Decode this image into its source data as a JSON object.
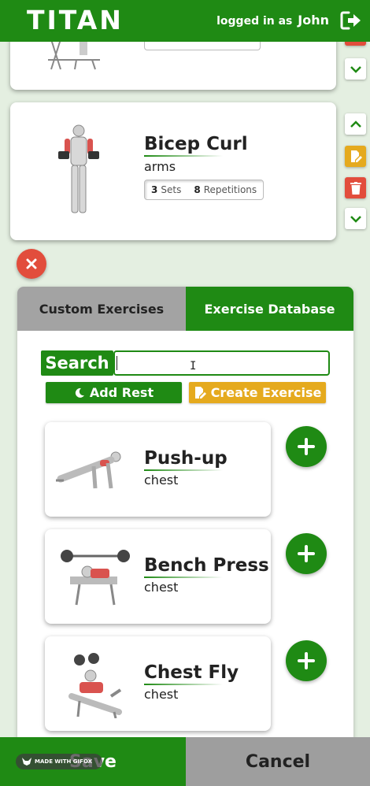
{
  "header": {
    "logo_text": "TITAN",
    "logged_in_prefix": "logged in as",
    "username": "John"
  },
  "routine": {
    "items": [
      {
        "name": "",
        "group": "",
        "sets": "",
        "reps": ""
      },
      {
        "name": "Bicep Curl",
        "group": "arms",
        "sets": "3",
        "sets_label": "Sets",
        "reps": "8",
        "reps_label": "Repetitions"
      }
    ]
  },
  "panel": {
    "tabs": [
      {
        "label": "Custom Exercises",
        "active": false
      },
      {
        "label": "Exercise Database",
        "active": true
      }
    ],
    "search_label": "Search",
    "search_value": "",
    "add_rest_label": "Add Rest",
    "create_exercise_label": "Create Exercise",
    "exercises": [
      {
        "name": "Push-up",
        "group": "chest"
      },
      {
        "name": "Bench Press",
        "group": "chest"
      },
      {
        "name": "Chest Fly",
        "group": "chest"
      }
    ]
  },
  "footer": {
    "save_label": "Save",
    "cancel_label": "Cancel",
    "watermark": "MADE WITH GIFOX"
  },
  "colors": {
    "primary_green": "#1f8a14",
    "warning_yellow": "#e5aa1e",
    "danger_red": "#e24d3c",
    "inactive_gray": "#a3a3a3",
    "background": "#e4efe1"
  }
}
